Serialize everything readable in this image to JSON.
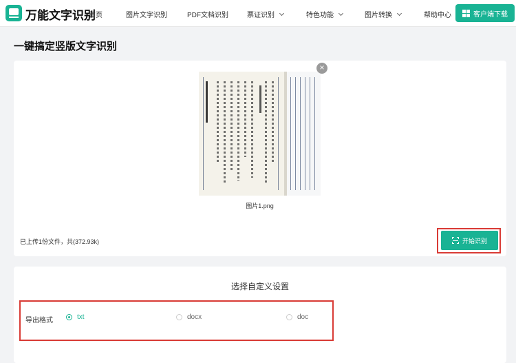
{
  "header": {
    "brand": "万能文字识别",
    "nav": [
      {
        "label": "首页",
        "dropdown": false
      },
      {
        "label": "图片文字识别",
        "dropdown": false
      },
      {
        "label": "PDF文档识别",
        "dropdown": false
      },
      {
        "label": "票证识别",
        "dropdown": true
      },
      {
        "label": "特色功能",
        "dropdown": true
      },
      {
        "label": "图片转换",
        "dropdown": true
      },
      {
        "label": "帮助中心",
        "dropdown": false
      }
    ],
    "download_label": "客户端下载"
  },
  "page_title": "一键搞定竖版文字识别",
  "upload": {
    "file_name": "图片1.png",
    "close_glyph": "×",
    "info": "已上传1份文件，共(372.93k)",
    "start_label": "开始识别"
  },
  "settings": {
    "title": "选择自定义设置",
    "format_label": "导出格式",
    "options": [
      {
        "label": "txt",
        "selected": true
      },
      {
        "label": "docx",
        "selected": false
      },
      {
        "label": "doc",
        "selected": false
      }
    ]
  },
  "colors": {
    "accent": "#19b394",
    "highlight": "#d93b35"
  }
}
